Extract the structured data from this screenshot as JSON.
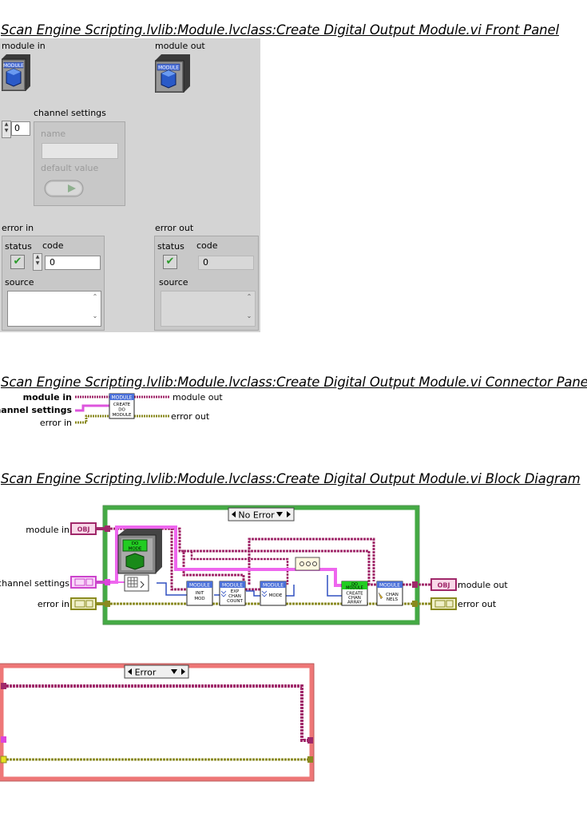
{
  "front_panel": {
    "title": "Scan Engine Scripting.lvlib:Module.lvclass:Create Digital Output Module.vi Front Panel",
    "module_in_label": "module in",
    "module_out_label": "module out",
    "module_icon_text": "MODULE",
    "channel_settings": {
      "label": "channel settings",
      "index": "0",
      "name_label": "name",
      "name_value": "",
      "default_value_label": "default value"
    },
    "error_in": {
      "label": "error in",
      "status_label": "status",
      "code_label": "code",
      "code_value": "0",
      "source_label": "source",
      "source_value": ""
    },
    "error_out": {
      "label": "error out",
      "status_label": "status",
      "code_label": "code",
      "code_value": "0",
      "source_label": "source",
      "source_value": ""
    }
  },
  "connector_pane": {
    "title": "Scan Engine Scripting.lvlib:Module.lvclass:Create Digital Output Module.vi Connector Pane",
    "inputs": [
      "module in",
      "channel settings",
      "error in"
    ],
    "outputs": [
      "module out",
      "error out"
    ],
    "icon_lines": [
      "MODULE",
      "CREATE",
      "DO",
      "MODULE"
    ]
  },
  "block_diagram": {
    "title": "Scan Engine Scripting.lvlib:Module.lvclass:Create Digital Output Module.vi Block Diagram",
    "case1_selector": "No Error",
    "case2_selector": "Error",
    "terminals": {
      "module_in": "module in",
      "channel_settings": "channel settings",
      "error_in": "error in",
      "module_out": "module out",
      "error_out": "error out"
    },
    "terminal_tags": {
      "obj": "OBJ"
    },
    "nodes": {
      "do_mode_top": "DO",
      "do_mode_bottom": "MODE",
      "init_header": "MODULE",
      "init_l1": "INIT",
      "init_l2": "MOD",
      "exp_header": "MODULE",
      "exp_l1": "EXP",
      "exp_l2": "CHAN",
      "exp_l3": "COUNT",
      "mode_header": "MODULE",
      "mode_l1": "MODE",
      "create_header": "DO",
      "create_header2": "MODULE",
      "create_l1": "CREATE",
      "create_l2": "CHAN",
      "create_l3": "ARRAY",
      "chan_header": "MODULE",
      "chan_l1": "CHAN",
      "chan_l2": "NELS"
    }
  },
  "colors": {
    "class_wire": "#a0286a",
    "cluster_wire": "#cc44cc",
    "error_wire": "#8a8a20",
    "case_border": "#44aa44",
    "error_case_border": "#dd5555",
    "module_blue": "#4a6fd8"
  }
}
